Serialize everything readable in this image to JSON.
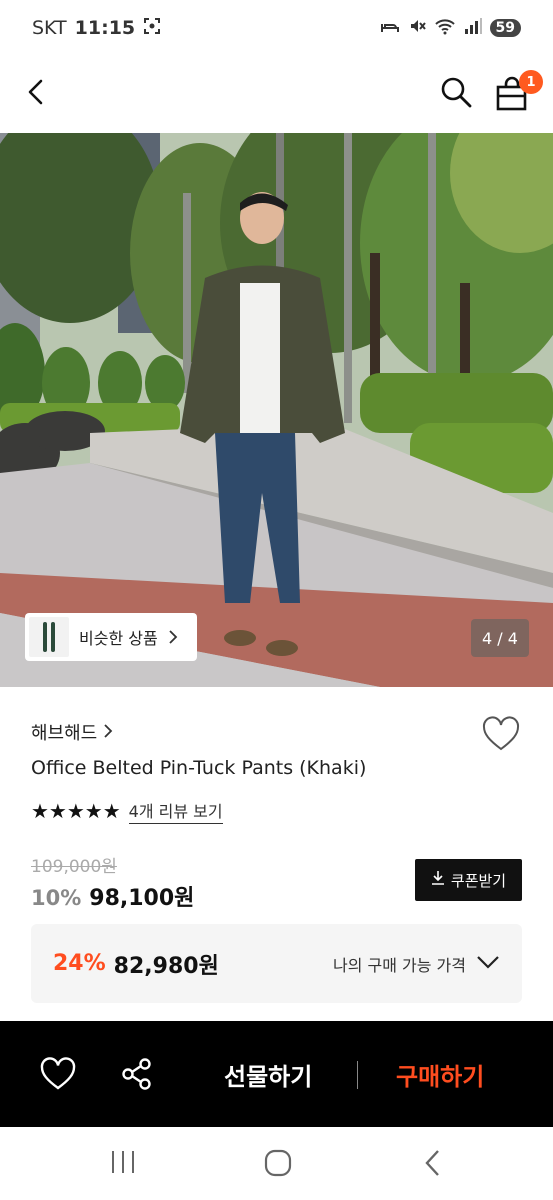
{
  "status_bar": {
    "carrier": "SKT",
    "time": "11:15",
    "battery": "59",
    "icons": [
      "screenshot-icon",
      "alarm-icon",
      "mute-icon",
      "wifi-icon",
      "signal-icon",
      "battery-icon"
    ]
  },
  "header": {
    "icons": [
      "back-arrow-icon",
      "search-icon",
      "shopping-bag-icon"
    ],
    "cart_count": "1"
  },
  "gallery": {
    "similar_label": "비슷한 상품",
    "counter": "4 / 4",
    "current_index": 4,
    "total": 4
  },
  "product": {
    "brand": "해브해드",
    "name": "Office Belted Pin-Tuck Pants (Khaki)",
    "stars": "★★★★★",
    "rating": 5,
    "review_link": "4개 리뷰 보기",
    "original_price": "109,000원",
    "discount_rate": "10%",
    "sale_price": "98,100원",
    "coupon_label": "쿠폰받기"
  },
  "best_price": {
    "rate": "24%",
    "price": "82,980원",
    "label": "나의 구매 가능 가격"
  },
  "action_bar": {
    "gift_label": "선물하기",
    "buy_label": "구매하기"
  },
  "colors": {
    "accent": "#ff4d1f",
    "badge": "#ff5a1f",
    "bar_bg": "#000000"
  }
}
